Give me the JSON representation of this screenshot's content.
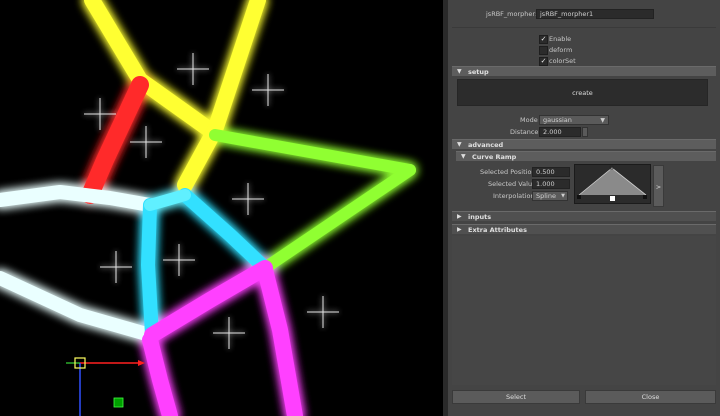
{
  "editor": {
    "node_label": "jsRBF_morpher:",
    "node_name": "jsRBF_morpher1",
    "enable_label": "Enable",
    "enable_checked": true,
    "deform_label": "deform",
    "deform_checked": false,
    "colorset_label": "colorSet",
    "colorset_checked": true,
    "setup_section": "setup",
    "create_label": "create",
    "mode_label": "Mode",
    "mode_value": "gaussian",
    "distance_label": "Distance",
    "distance_value": "2.000",
    "advanced_section": "advanced",
    "curve_ramp_section": "Curve Ramp",
    "selected_position_label": "Selected Position",
    "selected_position_value": "0.500",
    "selected_value_label": "Selected Value",
    "selected_value_value": "1.000",
    "interpolation_label": "Interpolation",
    "interpolation_value": "Spline",
    "ramp_expand_icon": ">",
    "inputs_section": "inputs",
    "extra_attributes_section": "Extra Attributes",
    "select_label": "Select",
    "close_label": "Close"
  },
  "icons": {
    "section_open": "triangle-down",
    "section_closed": "triangle-right",
    "checkbox_checked": "✓"
  },
  "colors": {
    "panel_bg": "#444444",
    "viewport_bg": "#000000",
    "glow_yellow": "#ffff00",
    "glow_red": "#ff2020",
    "glow_green": "#80ff20",
    "glow_cyan": "#20e0ff",
    "glow_magenta": "#ff40ff",
    "glow_white": "#ffffff"
  }
}
